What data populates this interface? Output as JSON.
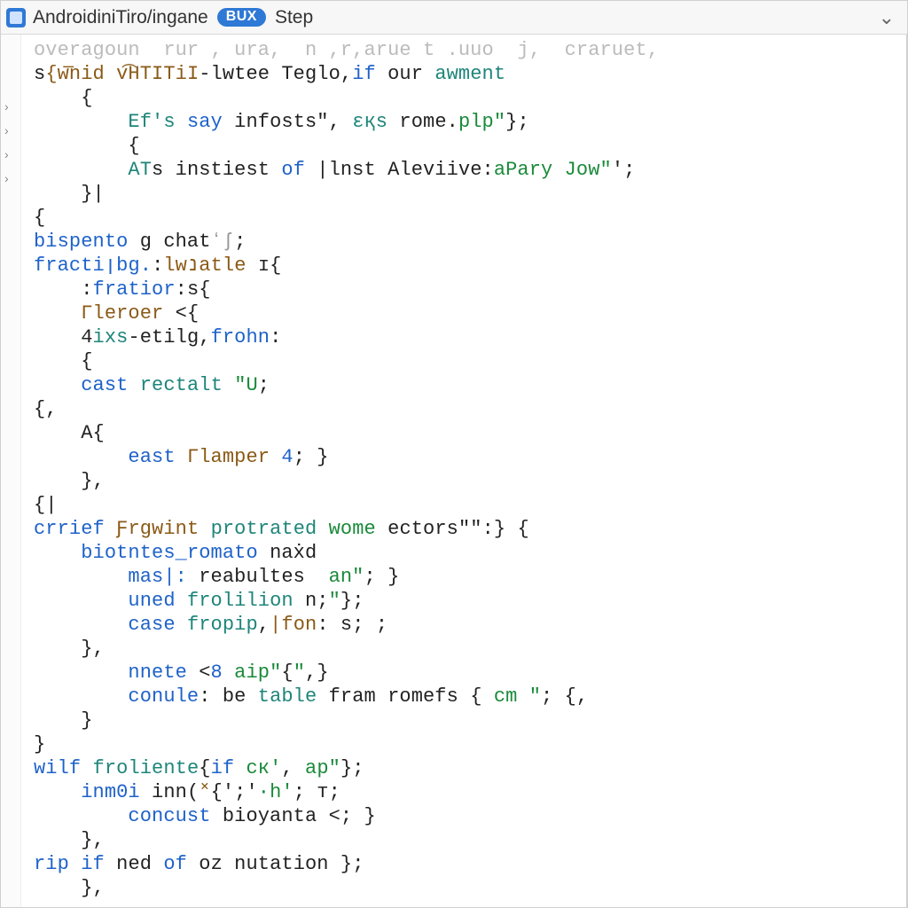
{
  "titlebar": {
    "project": "AndroidiniTiro",
    "sep": "/",
    "file": "ingane",
    "badge": "BUX",
    "action": "Step",
    "chevron_glyph": "⌄"
  },
  "gutter": {
    "fold_glyphs": [
      "›",
      "›",
      "›",
      "›"
    ]
  },
  "code": {
    "lines": [
      {
        "indent": 0,
        "tokens": [
          {
            "c": "faded",
            "t": "overagoun  rur , ura,  n ,r,arue t .uuo  j,  craruet,"
          }
        ]
      },
      {
        "indent": 0,
        "tokens": [
          {
            "c": "t-txt",
            "t": "s"
          },
          {
            "c": "t-fn",
            "t": "{͏w͞nid v͡HTITiI"
          },
          {
            "c": "t-txt",
            "t": "-lwtee Teglo,"
          },
          {
            "c": "t-kw",
            "t": "if"
          },
          {
            "c": "t-txt",
            "t": " our "
          },
          {
            "c": "t-id",
            "t": "awment"
          }
        ]
      },
      {
        "indent": 1,
        "tokens": [
          {
            "c": "t-txt",
            "t": "{"
          }
        ]
      },
      {
        "indent": 2,
        "tokens": [
          {
            "c": "t-id",
            "t": "Ef's"
          },
          {
            "c": "t-txt",
            "t": " "
          },
          {
            "c": "t-kw",
            "t": "say"
          },
          {
            "c": "t-txt",
            "t": " infosts\", "
          },
          {
            "c": "t-id",
            "t": "ɛқs"
          },
          {
            "c": "t-txt",
            "t": " rome."
          },
          {
            "c": "t-str",
            "t": "plp\""
          },
          {
            "c": "t-txt",
            "t": "};"
          }
        ]
      },
      {
        "indent": 2,
        "tokens": [
          {
            "c": "t-txt",
            "t": "{"
          }
        ]
      },
      {
        "indent": 2,
        "tokens": [
          {
            "c": "t-id",
            "t": "AT"
          },
          {
            "c": "t-txt",
            "t": "s instiest "
          },
          {
            "c": "t-kw",
            "t": "of"
          },
          {
            "c": "t-txt",
            "t": " |lnst Aleviive:"
          },
          {
            "c": "t-str",
            "t": "aPary Jow\""
          },
          {
            "c": "t-txt",
            "t": "';"
          }
        ]
      },
      {
        "indent": 1,
        "tokens": [
          {
            "c": "t-txt",
            "t": "}|"
          }
        ]
      },
      {
        "indent": 0,
        "tokens": [
          {
            "c": "t-txt",
            "t": "{"
          }
        ]
      },
      {
        "indent": 0,
        "tokens": [
          {
            "c": "t-kw",
            "t": "bispento"
          },
          {
            "c": "t-txt",
            "t": " g chat"
          },
          {
            "c": "t-dim",
            "t": "ʻʃ"
          },
          {
            "c": "t-txt",
            "t": ";"
          }
        ]
      },
      {
        "indent": 0,
        "tokens": [
          {
            "c": "t-kw",
            "t": "fractiןbg."
          },
          {
            "c": "t-txt",
            "t": ":"
          },
          {
            "c": "t-fn",
            "t": "lwנatle"
          },
          {
            "c": "t-txt",
            "t": " ɪ{"
          }
        ]
      },
      {
        "indent": 1,
        "tokens": [
          {
            "c": "t-txt",
            "t": ":"
          },
          {
            "c": "t-kw",
            "t": "fratior"
          },
          {
            "c": "t-txt",
            "t": ":s{"
          }
        ]
      },
      {
        "indent": 1,
        "tokens": [
          {
            "c": "t-fn",
            "t": "Γleroer"
          },
          {
            "c": "t-txt",
            "t": " <{"
          }
        ]
      },
      {
        "indent": 1,
        "tokens": [
          {
            "c": "t-txt",
            "t": "4"
          },
          {
            "c": "t-id",
            "t": "ixs"
          },
          {
            "c": "t-txt",
            "t": "-etilg,"
          },
          {
            "c": "t-kw",
            "t": "frohn"
          },
          {
            "c": "t-txt",
            "t": ":"
          }
        ]
      },
      {
        "indent": 1,
        "tokens": [
          {
            "c": "t-txt",
            "t": "{"
          }
        ]
      },
      {
        "indent": 1,
        "tokens": [
          {
            "c": "t-kw",
            "t": "cast"
          },
          {
            "c": "t-txt",
            "t": " "
          },
          {
            "c": "t-id",
            "t": "rectalt"
          },
          {
            "c": "t-txt",
            "t": " "
          },
          {
            "c": "t-str",
            "t": "\"U"
          },
          {
            "c": "t-txt",
            "t": ";"
          }
        ]
      },
      {
        "indent": 0,
        "tokens": [
          {
            "c": "t-txt",
            "t": "{,"
          }
        ]
      },
      {
        "indent": 1,
        "tokens": [
          {
            "c": "t-txt",
            "t": "A{"
          }
        ]
      },
      {
        "indent": 2,
        "tokens": [
          {
            "c": "t-kw",
            "t": "east"
          },
          {
            "c": "t-txt",
            "t": " "
          },
          {
            "c": "t-fn",
            "t": "Γlamper"
          },
          {
            "c": "t-txt",
            "t": " "
          },
          {
            "c": "t-num",
            "t": "4"
          },
          {
            "c": "t-txt",
            "t": "; }"
          }
        ]
      },
      {
        "indent": 1,
        "tokens": [
          {
            "c": "t-txt",
            "t": "},"
          }
        ]
      },
      {
        "indent": 0,
        "tokens": [
          {
            "c": "t-txt",
            "t": "{|"
          }
        ]
      },
      {
        "indent": 0,
        "tokens": [
          {
            "c": "t-kw",
            "t": "crrief"
          },
          {
            "c": "t-txt",
            "t": " "
          },
          {
            "c": "t-fn",
            "t": "Ƒrgwint"
          },
          {
            "c": "t-txt",
            "t": " "
          },
          {
            "c": "t-id",
            "t": "protrated"
          },
          {
            "c": "t-txt",
            "t": " "
          },
          {
            "c": "t-str",
            "t": "wome"
          },
          {
            "c": "t-txt",
            "t": " ectors\"\":} {"
          }
        ]
      },
      {
        "indent": 1,
        "tokens": [
          {
            "c": "t-kw",
            "t": "biotntes_romato"
          },
          {
            "c": "t-txt",
            "t": " naẋd"
          }
        ]
      },
      {
        "indent": 2,
        "tokens": [
          {
            "c": "t-kw",
            "t": "mas|:"
          },
          {
            "c": "t-txt",
            "t": " reabultes  "
          },
          {
            "c": "t-str",
            "t": "an\""
          },
          {
            "c": "t-txt",
            "t": "; }"
          }
        ]
      },
      {
        "indent": 2,
        "tokens": [
          {
            "c": "t-kw",
            "t": "uned"
          },
          {
            "c": "t-txt",
            "t": " "
          },
          {
            "c": "t-id",
            "t": "frolilion"
          },
          {
            "c": "t-txt",
            "t": " n;"
          },
          {
            "c": "t-str",
            "t": "\""
          },
          {
            "c": "t-txt",
            "t": "};"
          }
        ]
      },
      {
        "indent": 2,
        "tokens": [
          {
            "c": "t-kw",
            "t": "case"
          },
          {
            "c": "t-txt",
            "t": " "
          },
          {
            "c": "t-id",
            "t": "fropip"
          },
          {
            "c": "t-txt",
            "t": ","
          },
          {
            "c": "t-fn",
            "t": "|fon"
          },
          {
            "c": "t-txt",
            "t": ": s; ;"
          }
        ]
      },
      {
        "indent": 1,
        "tokens": [
          {
            "c": "t-txt",
            "t": "},"
          }
        ]
      },
      {
        "indent": 2,
        "tokens": [
          {
            "c": "t-kw",
            "t": "nnete"
          },
          {
            "c": "t-txt",
            "t": " <"
          },
          {
            "c": "t-num",
            "t": "8"
          },
          {
            "c": "t-txt",
            "t": " "
          },
          {
            "c": "t-str",
            "t": "aip\""
          },
          {
            "c": "t-txt",
            "t": "{"
          },
          {
            "c": "t-str",
            "t": "\""
          },
          {
            "c": "t-txt",
            "t": ",}"
          }
        ]
      },
      {
        "indent": 2,
        "tokens": [
          {
            "c": "t-kw",
            "t": "conule"
          },
          {
            "c": "t-txt",
            "t": ": be "
          },
          {
            "c": "t-id",
            "t": "table"
          },
          {
            "c": "t-txt",
            "t": " fram romefs { "
          },
          {
            "c": "t-str",
            "t": "cm \""
          },
          {
            "c": "t-txt",
            "t": "; {,"
          }
        ]
      },
      {
        "indent": 1,
        "tokens": [
          {
            "c": "t-txt",
            "t": "}"
          }
        ]
      },
      {
        "indent": 0,
        "tokens": [
          {
            "c": "t-txt",
            "t": "}"
          }
        ]
      },
      {
        "indent": 0,
        "tokens": [
          {
            "c": "t-kw",
            "t": "wilf"
          },
          {
            "c": "t-txt",
            "t": " "
          },
          {
            "c": "t-id",
            "t": "froliente"
          },
          {
            "c": "t-txt",
            "t": "{"
          },
          {
            "c": "t-kw",
            "t": "if"
          },
          {
            "c": "t-txt",
            "t": " "
          },
          {
            "c": "t-str",
            "t": "cк'"
          },
          {
            "c": "t-txt",
            "t": ", "
          },
          {
            "c": "t-str",
            "t": "ap\""
          },
          {
            "c": "t-txt",
            "t": "};"
          }
        ]
      },
      {
        "indent": 1,
        "tokens": [
          {
            "c": "t-kw",
            "t": "inm0i"
          },
          {
            "c": "t-txt",
            "t": " inn("
          },
          {
            "c": "t-fn",
            "t": "˟"
          },
          {
            "c": "t-txt",
            "t": "{';'"
          },
          {
            "c": "t-str",
            "t": "·h'"
          },
          {
            "c": "t-txt",
            "t": "; т;"
          }
        ]
      },
      {
        "indent": 2,
        "tokens": [
          {
            "c": "t-kw",
            "t": "concust"
          },
          {
            "c": "t-txt",
            "t": " bioyanta <; }"
          }
        ]
      },
      {
        "indent": 1,
        "tokens": [
          {
            "c": "t-txt",
            "t": "},"
          }
        ]
      },
      {
        "indent": 0,
        "tokens": [
          {
            "c": "t-kw",
            "t": "rip"
          },
          {
            "c": "t-txt",
            "t": " "
          },
          {
            "c": "t-kw",
            "t": "if"
          },
          {
            "c": "t-txt",
            "t": " ned "
          },
          {
            "c": "t-kw",
            "t": "of"
          },
          {
            "c": "t-txt",
            "t": " oz nutation };"
          }
        ]
      },
      {
        "indent": 1,
        "tokens": [
          {
            "c": "t-txt",
            "t": "},"
          }
        ]
      }
    ]
  }
}
